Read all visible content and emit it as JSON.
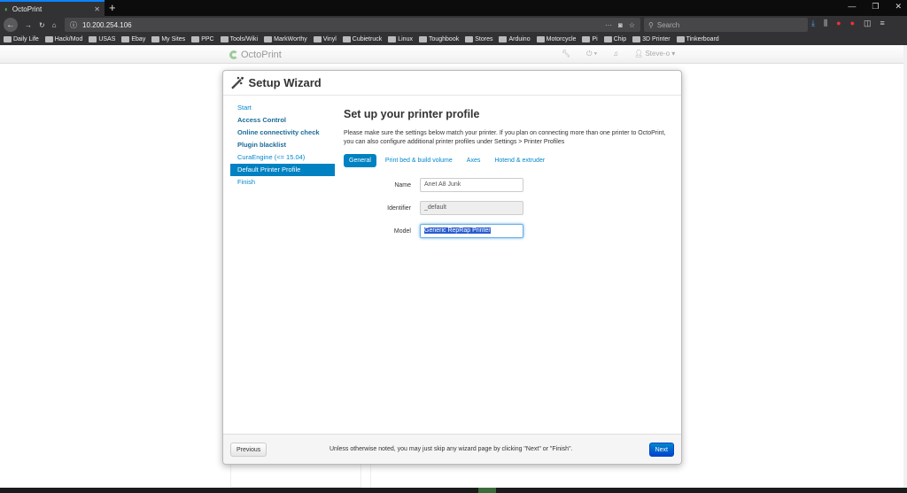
{
  "browser": {
    "tab_title": "OctoPrint",
    "url": "10.200.254.106",
    "search_placeholder": "Search",
    "bookmarks": [
      "Daily Life",
      "Hack/Mod",
      "USAS",
      "Ebay",
      "My Sites",
      "PPC",
      "Tools/Wiki",
      "MarkWorthy",
      "Vinyl",
      "Cubietruck",
      "Linux",
      "Toughbook",
      "Stores",
      "Arduino",
      "Motorcycle",
      "Pi",
      "Chip",
      "3D Printer",
      "Tinkerboard"
    ]
  },
  "octoprint": {
    "brand": "OctoPrint",
    "user": "Steve-o"
  },
  "wizard": {
    "title": "Setup Wizard",
    "steps": [
      {
        "label": "Start"
      },
      {
        "label": "Access Control"
      },
      {
        "label": "Online connectivity check"
      },
      {
        "label": "Plugin blacklist"
      },
      {
        "label": "CuraEngine (<= 15.04)"
      },
      {
        "label": "Default Printer Profile"
      },
      {
        "label": "Finish"
      }
    ],
    "heading": "Set up your printer profile",
    "description": "Please make sure the settings below match your printer. If you plan on connecting more than one printer to OctoPrint, you can also configure additional printer profiles under Settings > Printer Profiles",
    "tabs": [
      "General",
      "Print bed & build volume",
      "Axes",
      "Hotend & extruder"
    ],
    "fields": {
      "name_label": "Name",
      "name_value": "Anet A8 Junk",
      "identifier_label": "Identifier",
      "identifier_value": "_default",
      "model_label": "Model",
      "model_value": "Generic RepRap Printer"
    },
    "footer": {
      "previous": "Previous",
      "note": "Unless otherwise noted, you may just skip any wizard page by clicking \"Next\" or \"Finish\".",
      "next": "Next"
    }
  }
}
